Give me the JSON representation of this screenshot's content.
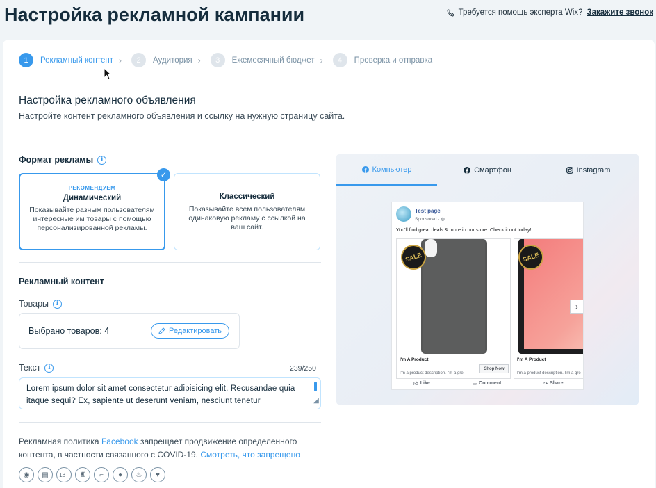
{
  "page": {
    "title": "Настройка рекламной кампании",
    "help_text": "Требуется помощь эксперта Wix?",
    "help_link": "Закажите звонок"
  },
  "stepper": [
    {
      "num": "1",
      "label": "Рекламный контент",
      "active": true
    },
    {
      "num": "2",
      "label": "Аудитория",
      "active": false
    },
    {
      "num": "3",
      "label": "Ежемесячный бюджет",
      "active": false
    },
    {
      "num": "4",
      "label": "Проверка и отправка",
      "active": false
    }
  ],
  "section": {
    "title": "Настройка рекламного объявления",
    "subtitle": "Настройте контент рекламного объявления и ссылку на нужную страницу сайта."
  },
  "format": {
    "heading": "Формат рекламы",
    "dynamic": {
      "tag": "РЕКОМЕНДУЕМ",
      "name": "Динамический",
      "desc": "Показывайте разным пользователям интересные им товары с помощью персонализированной рекламы."
    },
    "classic": {
      "name": "Классический",
      "desc": "Показывайте всем пользователям одинаковую рекламу с ссылкой на ваш сайт."
    }
  },
  "content": {
    "heading": "Рекламный контент",
    "products_label": "Товары",
    "products_selected": "Выбрано товаров: 4",
    "edit_button": "Редактировать",
    "text_label": "Текст",
    "counter": "239/250",
    "text_value": "Lorem ipsum dolor sit amet consectetur adipisicing elit. Recusandae quia itaque sequi? Ex, sapiente ut deserunt veniam, nesciunt tenetur"
  },
  "policy": {
    "text_before": "Рекламная политика ",
    "facebook": "Facebook",
    "text_after": " запрещает продвижение определенного контента, в частности связанного с COVID-19. ",
    "link": "Смотреть, что запрещено",
    "icons": [
      "mask-icon",
      "pill-bottle-icon",
      "18plus-icon",
      "bottle-icon",
      "gun-icon",
      "bomb-icon",
      "smoking-icon",
      "heart-icon"
    ],
    "icon_glyphs": [
      "◉",
      "▤",
      "18+",
      "♜",
      "⌐",
      "●",
      "♨",
      "♥"
    ]
  },
  "preview": {
    "tabs": [
      "Компьютер",
      "Смартфон",
      "Instagram"
    ],
    "active_tab": "Компьютер",
    "page_name": "Test page",
    "sponsored": "Sponsored · ",
    "message": "You'll find great deals & more in our store. Check it out today!",
    "products": [
      {
        "title": "I'm A Product",
        "desc": "I'm a product description. I'm a gre",
        "sale": "SALE",
        "cta": "Shop Now"
      },
      {
        "title": "I'm A Product",
        "desc": "I'm a product description. I'm a gre",
        "sale": "SALE"
      }
    ],
    "actions": [
      "Like",
      "Comment",
      "Share"
    ]
  },
  "colors": {
    "accent": "#3899ec",
    "title": "#162d3d",
    "facebook_link": "#385898"
  }
}
